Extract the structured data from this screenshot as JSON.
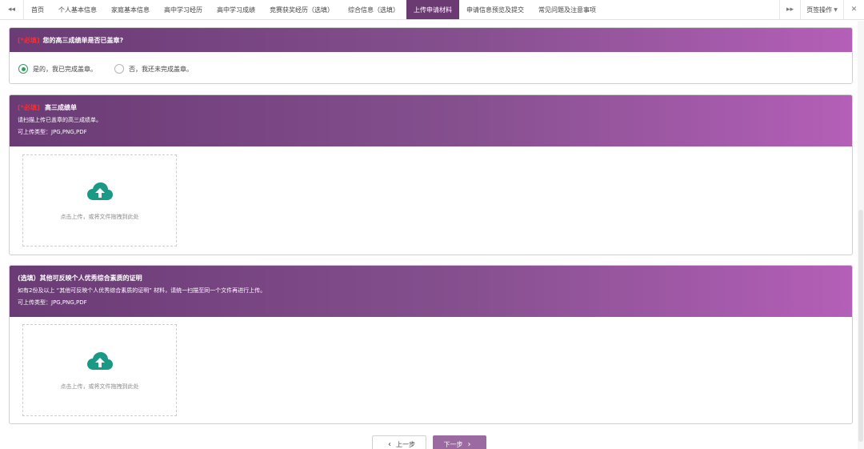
{
  "tabbar": {
    "nav_back": "◂◂",
    "nav_fwd": "▸▸",
    "close_all": "✕",
    "ops_label": "页签操作",
    "tabs": [
      "首页",
      "个人基本信息",
      "家庭基本信息",
      "高中学习经历",
      "高中学习成绩",
      "竞赛获奖经历（选填）",
      "综合信息（选填）",
      "上传申请材料",
      "申请信息预览及提交",
      "常见问题及注意事项"
    ],
    "active_tab": "上传申请材料"
  },
  "section1": {
    "required_mark": "[*必填]",
    "title": "您的高三成绩单是否已盖章?",
    "options": [
      "是的，我已完成盖章。",
      "否，我还未完成盖章。"
    ],
    "selected": "是的，我已完成盖章。"
  },
  "section2": {
    "required_mark": "[*必填]",
    "title": "高三成绩单",
    "desc": "请扫描上传已盖章的高三成绩单。",
    "types": "可上传类型：JPG,PNG,PDF",
    "upload_hint": "点击上传，或将文件拖拽到此处"
  },
  "section3": {
    "title": "(选填）其他可反映个人优秀综合素质的证明",
    "desc": "如有2份及以上 “其他可反映个人优秀综合素质的证明” 材料，请统一扫描至同一个文件再进行上传。",
    "types": "可上传类型：JPG,PNG,PDF",
    "upload_hint": "点击上传，或将文件拖拽到此处"
  },
  "footer": {
    "prev_label": "上一步",
    "next_label": "下一步"
  },
  "colors": {
    "accent": "#6b3a73",
    "header_gradient_start": "#6a3b75",
    "header_gradient_end": "#b45fb8",
    "upload_icon": "#1a9a86",
    "required": "#ff2b2b"
  }
}
